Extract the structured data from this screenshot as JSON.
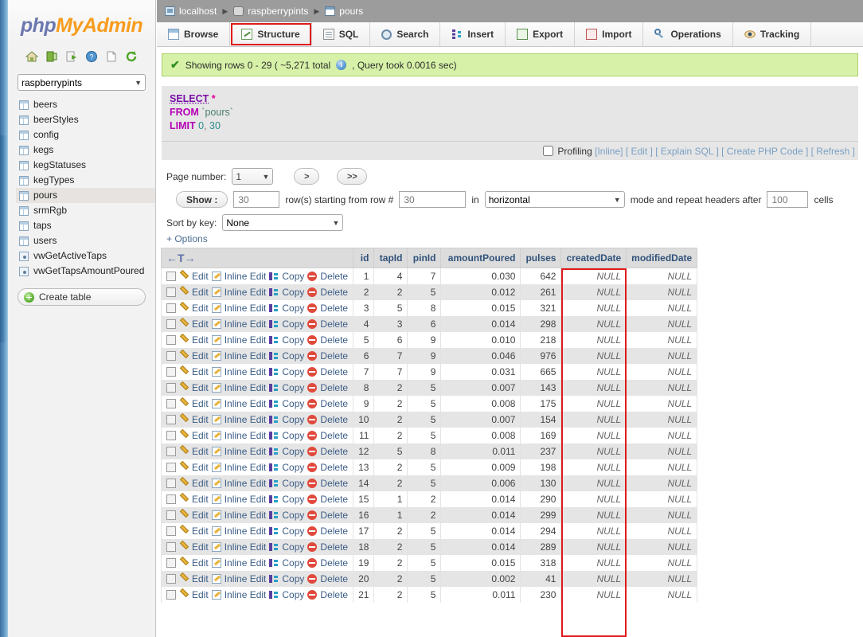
{
  "brand": {
    "part1": "php",
    "part2": "MyAdmin"
  },
  "sidebar": {
    "icons": [
      "home-icon",
      "logout-icon",
      "export-icon",
      "help-icon",
      "docs-icon",
      "reload-icon"
    ],
    "database_selected": "raspberrypints",
    "tables": [
      {
        "name": "beers",
        "type": "table"
      },
      {
        "name": "beerStyles",
        "type": "table"
      },
      {
        "name": "config",
        "type": "table"
      },
      {
        "name": "kegs",
        "type": "table"
      },
      {
        "name": "kegStatuses",
        "type": "table"
      },
      {
        "name": "kegTypes",
        "type": "table"
      },
      {
        "name": "pours",
        "type": "table",
        "active": true
      },
      {
        "name": "srmRgb",
        "type": "table"
      },
      {
        "name": "taps",
        "type": "table"
      },
      {
        "name": "users",
        "type": "table"
      },
      {
        "name": "vwGetActiveTaps",
        "type": "view"
      },
      {
        "name": "vwGetTapsAmountPoured",
        "type": "view"
      }
    ],
    "create_table_label": "Create table"
  },
  "breadcrumb": [
    {
      "label": "localhost",
      "icon": "server-icon"
    },
    {
      "label": "raspberrypints",
      "icon": "database-icon"
    },
    {
      "label": "pours",
      "icon": "table-icon"
    }
  ],
  "tabs": [
    {
      "label": "Browse",
      "icon": "browse-icon"
    },
    {
      "label": "Structure",
      "icon": "structure-icon",
      "highlighted": true
    },
    {
      "label": "SQL",
      "icon": "sql-icon"
    },
    {
      "label": "Search",
      "icon": "search-icon"
    },
    {
      "label": "Insert",
      "icon": "insert-icon"
    },
    {
      "label": "Export",
      "icon": "export-icon"
    },
    {
      "label": "Import",
      "icon": "import-icon"
    },
    {
      "label": "Operations",
      "icon": "operations-icon"
    },
    {
      "label": "Tracking",
      "icon": "tracking-icon"
    }
  ],
  "notice": {
    "prefix": "Showing rows 0 - 29 (  ~5,271 total",
    "suffix": ", Query took 0.0016 sec)"
  },
  "sql": {
    "select_kw": "SELECT",
    "star": "*",
    "from_kw": "FROM",
    "table": "`pours`",
    "limit_kw": "LIMIT",
    "limit_start": "0",
    "comma": ",",
    "limit_count": "30"
  },
  "sql_actions": {
    "profiling": "Profiling",
    "inline": "[Inline]",
    "edit": "[ Edit ]",
    "explain": "[ Explain SQL ]",
    "php": "[ Create PHP Code ]",
    "refresh": "[ Refresh ]"
  },
  "controls": {
    "page_number_label": "Page number:",
    "page_number_value": "1",
    "next_label": ">",
    "last_label": ">>",
    "show_label": "Show :",
    "rows_value": "30",
    "rows_text": "row(s) starting from row #",
    "start_row_value": "30",
    "in_label": "in",
    "mode_value": "horizontal",
    "mode_text": "mode and repeat headers after",
    "headers_value": "100",
    "cells_label": "cells",
    "sort_label": "Sort by key:",
    "sort_value": "None",
    "options_label": "+ Options"
  },
  "results": {
    "sort_arrows": "←T→",
    "columns": [
      "id",
      "tapId",
      "pinId",
      "amountPoured",
      "pulses",
      "createdDate",
      "modifiedDate"
    ],
    "row_actions": [
      "Edit",
      "Inline Edit",
      "Copy",
      "Delete"
    ],
    "highlighted_column": "createdDate",
    "rows": [
      {
        "id": "1",
        "tapId": "4",
        "pinId": "7",
        "amountPoured": "0.030",
        "pulses": "642",
        "createdDate": "NULL",
        "modifiedDate": "NULL"
      },
      {
        "id": "2",
        "tapId": "2",
        "pinId": "5",
        "amountPoured": "0.012",
        "pulses": "261",
        "createdDate": "NULL",
        "modifiedDate": "NULL"
      },
      {
        "id": "3",
        "tapId": "5",
        "pinId": "8",
        "amountPoured": "0.015",
        "pulses": "321",
        "createdDate": "NULL",
        "modifiedDate": "NULL"
      },
      {
        "id": "4",
        "tapId": "3",
        "pinId": "6",
        "amountPoured": "0.014",
        "pulses": "298",
        "createdDate": "NULL",
        "modifiedDate": "NULL"
      },
      {
        "id": "5",
        "tapId": "6",
        "pinId": "9",
        "amountPoured": "0.010",
        "pulses": "218",
        "createdDate": "NULL",
        "modifiedDate": "NULL"
      },
      {
        "id": "6",
        "tapId": "7",
        "pinId": "9",
        "amountPoured": "0.046",
        "pulses": "976",
        "createdDate": "NULL",
        "modifiedDate": "NULL"
      },
      {
        "id": "7",
        "tapId": "7",
        "pinId": "9",
        "amountPoured": "0.031",
        "pulses": "665",
        "createdDate": "NULL",
        "modifiedDate": "NULL"
      },
      {
        "id": "8",
        "tapId": "2",
        "pinId": "5",
        "amountPoured": "0.007",
        "pulses": "143",
        "createdDate": "NULL",
        "modifiedDate": "NULL"
      },
      {
        "id": "9",
        "tapId": "2",
        "pinId": "5",
        "amountPoured": "0.008",
        "pulses": "175",
        "createdDate": "NULL",
        "modifiedDate": "NULL"
      },
      {
        "id": "10",
        "tapId": "2",
        "pinId": "5",
        "amountPoured": "0.007",
        "pulses": "154",
        "createdDate": "NULL",
        "modifiedDate": "NULL"
      },
      {
        "id": "11",
        "tapId": "2",
        "pinId": "5",
        "amountPoured": "0.008",
        "pulses": "169",
        "createdDate": "NULL",
        "modifiedDate": "NULL"
      },
      {
        "id": "12",
        "tapId": "5",
        "pinId": "8",
        "amountPoured": "0.011",
        "pulses": "237",
        "createdDate": "NULL",
        "modifiedDate": "NULL"
      },
      {
        "id": "13",
        "tapId": "2",
        "pinId": "5",
        "amountPoured": "0.009",
        "pulses": "198",
        "createdDate": "NULL",
        "modifiedDate": "NULL"
      },
      {
        "id": "14",
        "tapId": "2",
        "pinId": "5",
        "amountPoured": "0.006",
        "pulses": "130",
        "createdDate": "NULL",
        "modifiedDate": "NULL"
      },
      {
        "id": "15",
        "tapId": "1",
        "pinId": "2",
        "amountPoured": "0.014",
        "pulses": "290",
        "createdDate": "NULL",
        "modifiedDate": "NULL"
      },
      {
        "id": "16",
        "tapId": "1",
        "pinId": "2",
        "amountPoured": "0.014",
        "pulses": "299",
        "createdDate": "NULL",
        "modifiedDate": "NULL"
      },
      {
        "id": "17",
        "tapId": "2",
        "pinId": "5",
        "amountPoured": "0.014",
        "pulses": "294",
        "createdDate": "NULL",
        "modifiedDate": "NULL"
      },
      {
        "id": "18",
        "tapId": "2",
        "pinId": "5",
        "amountPoured": "0.014",
        "pulses": "289",
        "createdDate": "NULL",
        "modifiedDate": "NULL"
      },
      {
        "id": "19",
        "tapId": "2",
        "pinId": "5",
        "amountPoured": "0.015",
        "pulses": "318",
        "createdDate": "NULL",
        "modifiedDate": "NULL"
      },
      {
        "id": "20",
        "tapId": "2",
        "pinId": "5",
        "amountPoured": "0.002",
        "pulses": "41",
        "createdDate": "NULL",
        "modifiedDate": "NULL"
      },
      {
        "id": "21",
        "tapId": "2",
        "pinId": "5",
        "amountPoured": "0.011",
        "pulses": "230",
        "createdDate": "NULL",
        "modifiedDate": "NULL"
      }
    ]
  },
  "colors": {
    "brand_orange": "#f79c1e",
    "brand_purple": "#6c78af",
    "notice_green": "#d7f2a8",
    "highlight_red": "#e01b1b",
    "breadcrumb_grey": "#9c9c9c"
  }
}
